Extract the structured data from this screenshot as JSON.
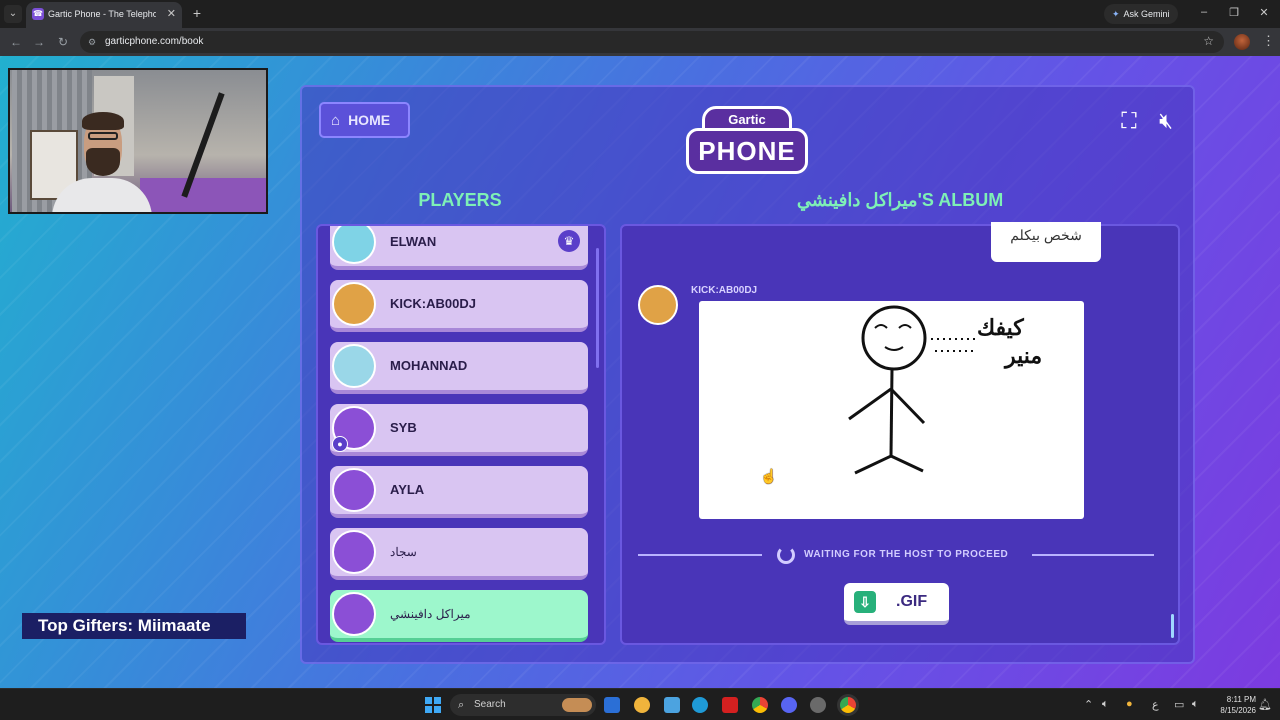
{
  "browser": {
    "tab_title": "Gartic Phone - The Telephone G",
    "tab_favicon": "☎",
    "gemini_label": "Ask Gemini",
    "url": "garticphone.com/book"
  },
  "stream": {
    "top_gifters": "Top Gifters: Miimaate"
  },
  "game": {
    "home_label": "HOME",
    "logo_top": "Gartic",
    "logo_bottom": "PHONE",
    "players_title": "PLAYERS",
    "album_title": "ميراكل دافينشي'S ALBUM",
    "players": [
      {
        "name": "ELWAN",
        "avatar_color": "#7fd3e6",
        "crown": true
      },
      {
        "name": "KICK:AB00DJ",
        "avatar_color": "#e0a246"
      },
      {
        "name": "MOHANNAD",
        "avatar_color": "#9ad7e8"
      },
      {
        "name": "SYB",
        "avatar_color": "#8b4fd6",
        "host_badge": true
      },
      {
        "name": "AYLA",
        "avatar_color": "#8b4fd6"
      },
      {
        "name": "سجاد",
        "avatar_color": "#8b4fd6",
        "arabic": true
      },
      {
        "name": "ميراكل دافينشي",
        "avatar_color": "#8b4fd6",
        "arabic": true,
        "selected": true
      }
    ],
    "bubble_text": "شخص بيكلم",
    "drawing_author": "KICK:AB00DJ",
    "drawing_caption_line1": "كيفك",
    "drawing_caption_line2": "منير",
    "waiting_text": "WAITING FOR THE HOST TO PROCEED",
    "gif_label": ".GIF"
  },
  "taskbar": {
    "search_placeholder": "Search",
    "time": "8:11 PM",
    "date": "8/15/2026",
    "lang": "ع"
  },
  "colors": {
    "accent_green": "#7ef0b6",
    "panel": "#4935b8",
    "player_card": "#d9c5f2",
    "selected_card": "#9df7cc"
  }
}
